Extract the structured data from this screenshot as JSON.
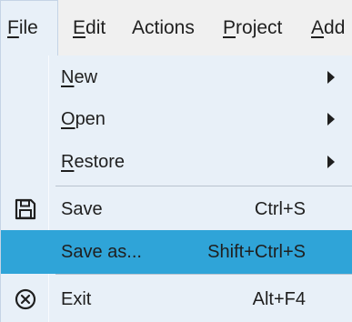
{
  "menubar": {
    "items": [
      {
        "label": "File",
        "mnemonic": "F",
        "rest": "ile"
      },
      {
        "label": "Edit",
        "mnemonic": "E",
        "rest": "dit"
      },
      {
        "label": "Actions"
      },
      {
        "label": "Project",
        "mnemonic": "P",
        "rest": "roject"
      },
      {
        "label": "Add",
        "mnemonic": "A",
        "rest": "dd"
      }
    ]
  },
  "file_menu": {
    "new": {
      "mnemonic": "N",
      "rest": "ew",
      "has_submenu": true
    },
    "open": {
      "mnemonic": "O",
      "rest": "pen",
      "has_submenu": true
    },
    "restore": {
      "mnemonic": "R",
      "rest": "estore",
      "has_submenu": true
    },
    "save": {
      "label": "Save",
      "shortcut": "Ctrl+S",
      "icon": "floppy-disk-icon"
    },
    "save_as": {
      "label": "Save as...",
      "shortcut": "Shift+Ctrl+S"
    },
    "exit": {
      "label": "Exit",
      "shortcut": "Alt+F4",
      "icon": "close-circle-icon"
    }
  },
  "colors": {
    "menubar_bg": "#f0f0f0",
    "dropdown_bg": "#e8f0f8",
    "highlight": "#2fa4d8",
    "text": "#1f1f1f"
  }
}
